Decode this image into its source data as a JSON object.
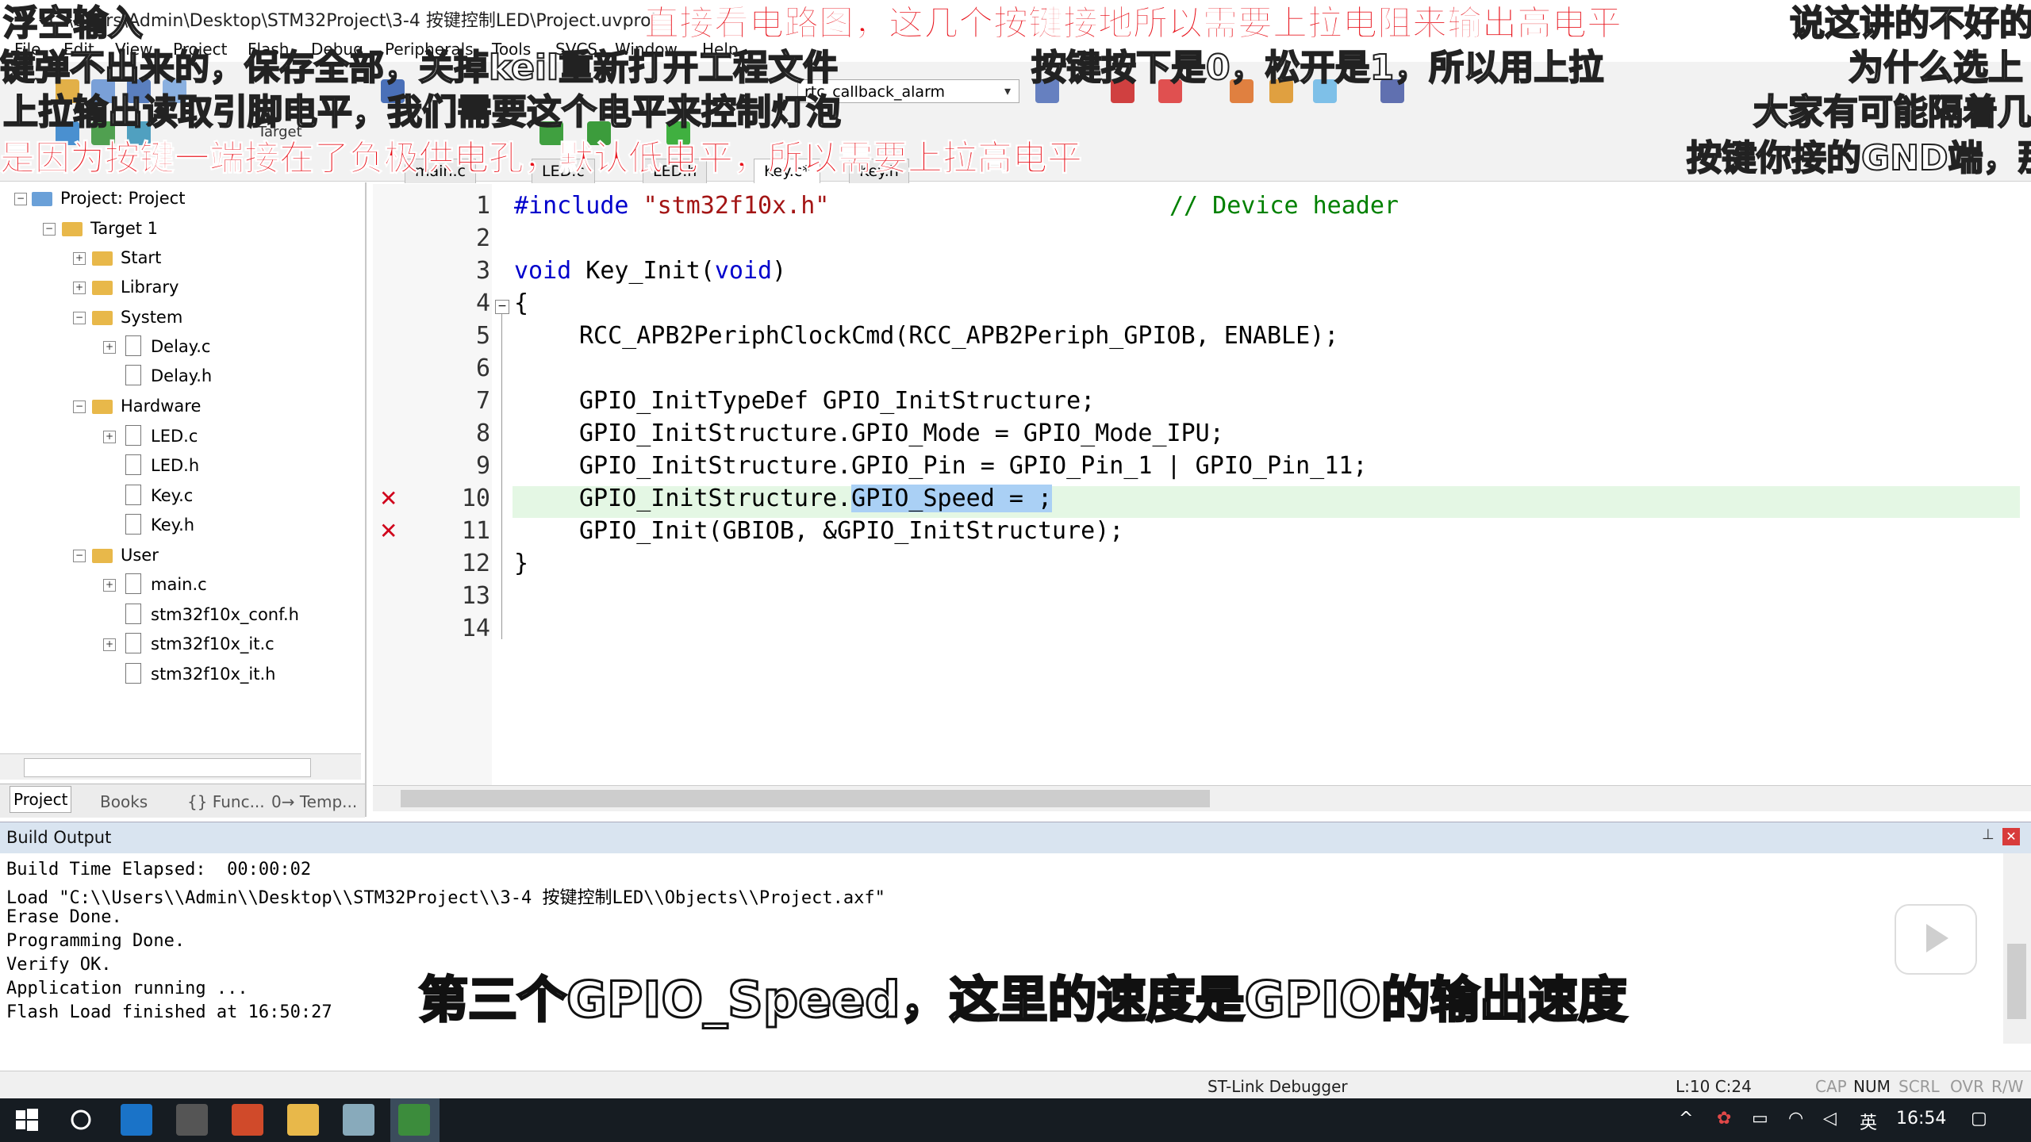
{
  "window": {
    "title": "C:\\Users\\Admin\\Desktop\\STM32Project\\3-4 按键控制LED\\Project.uvproj"
  },
  "menu": [
    "File",
    "Edit",
    "View",
    "Project",
    "Flash",
    "Debug",
    "Peripherals",
    "Tools",
    "SVCS",
    "Window",
    "Help"
  ],
  "toolbar": {
    "target_combo": "rtc_callback_alarm",
    "target_label": "Target"
  },
  "file_tabs": [
    {
      "label": "main.c",
      "active": false
    },
    {
      "label": "LED.c",
      "active": false
    },
    {
      "label": "LED.h",
      "active": false
    },
    {
      "label": "Key.c*",
      "active": true
    },
    {
      "label": "Key.h",
      "active": false
    }
  ],
  "project_tree": [
    {
      "label": "Project: Project",
      "level": 0,
      "type": "project",
      "expander": "−"
    },
    {
      "label": "Target 1",
      "level": 1,
      "type": "folder",
      "expander": "−"
    },
    {
      "label": "Start",
      "level": 2,
      "type": "folder",
      "expander": "+"
    },
    {
      "label": "Library",
      "level": 2,
      "type": "folder",
      "expander": "+"
    },
    {
      "label": "System",
      "level": 2,
      "type": "folder",
      "expander": "−"
    },
    {
      "label": "Delay.c",
      "level": 3,
      "type": "file",
      "expander": "+"
    },
    {
      "label": "Delay.h",
      "level": 3,
      "type": "file",
      "expander": ""
    },
    {
      "label": "Hardware",
      "level": 2,
      "type": "folder",
      "expander": "−"
    },
    {
      "label": "LED.c",
      "level": 3,
      "type": "file",
      "expander": "+"
    },
    {
      "label": "LED.h",
      "level": 3,
      "type": "file",
      "expander": ""
    },
    {
      "label": "Key.c",
      "level": 3,
      "type": "file",
      "expander": ""
    },
    {
      "label": "Key.h",
      "level": 3,
      "type": "file",
      "expander": ""
    },
    {
      "label": "User",
      "level": 2,
      "type": "folder",
      "expander": "−"
    },
    {
      "label": "main.c",
      "level": 3,
      "type": "file",
      "expander": "+"
    },
    {
      "label": "stm32f10x_conf.h",
      "level": 3,
      "type": "file",
      "expander": ""
    },
    {
      "label": "stm32f10x_it.c",
      "level": 3,
      "type": "file",
      "expander": "+"
    },
    {
      "label": "stm32f10x_it.h",
      "level": 3,
      "type": "file",
      "expander": ""
    }
  ],
  "pane_tabs": [
    "Project",
    "Books",
    "{} Func...",
    "0→ Temp..."
  ],
  "code": {
    "line_numbers": [
      "1",
      "2",
      "3",
      "4",
      "5",
      "6",
      "7",
      "8",
      "9",
      "10",
      "11",
      "12",
      "13",
      "14"
    ],
    "l1_include": "#include ",
    "l1_header": "\"stm32f10x.h\"",
    "l1_comment": "// Device header",
    "l3_void": "void",
    "l3_func": " Key_Init(",
    "l3_param": "void",
    "l3_close": ")",
    "l4": "{",
    "l5": "RCC_APB2PeriphClockCmd(RCC_APB2Periph_GPIOB, ENABLE);",
    "l7": "GPIO_InitTypeDef GPIO_InitStructure;",
    "l8": "GPIO_InitStructure.GPIO_Mode = GPIO_Mode_IPU;",
    "l9": "GPIO_InitStructure.GPIO_Pin = GPIO_Pin_1 | GPIO_Pin_11;",
    "l10_pre": "GPIO_InitStructure.",
    "l10_sel": "GPIO_Speed = ;",
    "l11": "GPIO_Init(GBIOB, &GPIO_InitStructure);",
    "l12": "}"
  },
  "build": {
    "title": "Build Output",
    "lines": [
      "Build Time Elapsed:  00:00:02",
      "Load \"C:\\\\Users\\\\Admin\\\\Desktop\\\\STM32Project\\\\3-4 按键控制LED\\\\Objects\\\\Project.axf\"",
      "Erase Done.",
      "Programming Done.",
      "Verify OK.",
      "Application running ...",
      "Flash Load finished at 16:50:27"
    ]
  },
  "status": {
    "debugger": "ST-Link Debugger",
    "position": "L:10 C:24",
    "cap": "CAP",
    "num": "NUM",
    "scrl": "SCRL",
    "ovr": "OVR",
    "rw": "R/W"
  },
  "taskbar": {
    "ime": "英",
    "clock": "16:54"
  },
  "subtitles": {
    "top_left_1": "浮空输入",
    "top_left_2": "键弹不出来的，保存全部，关掉keil重新打开工程文件",
    "top_left_3": "上拉输出读取引脚电平，我们需要这个电平来控制灯泡",
    "top_left_4_red": "是因为按键一端接在了负极供电孔，默认低电平，所以需要上拉高电平",
    "top_center_red": "直接看电路图，这几个按键接地所以需要上拉电阻来输出高电平",
    "top_center_2": "按键按下是0，松开是1，所以用上拉",
    "top_right_1": "说这讲的不好的",
    "top_right_2": "为什么选上",
    "top_right_3": "大家有可能隔着几",
    "top_right_4": "按键你接的GND端，那",
    "bottom_main": "第三个GPIO_Speed，这里的速度是GPIO的输出速度"
  }
}
